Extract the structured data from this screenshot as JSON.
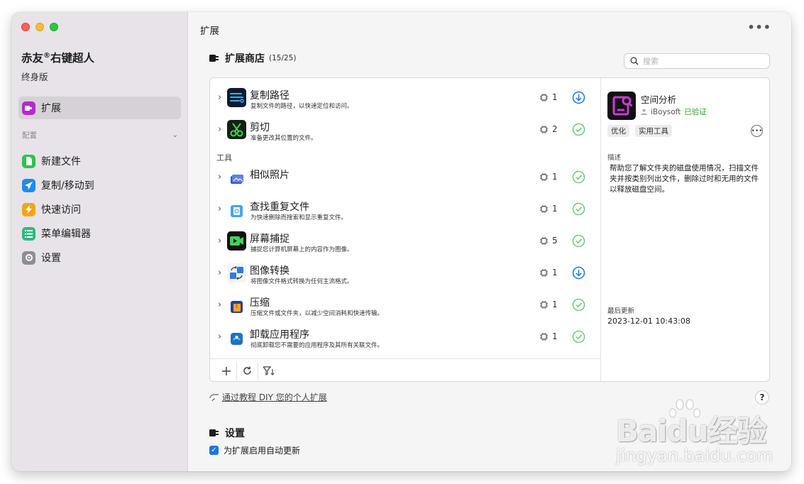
{
  "sidebar": {
    "app_name": "赤友",
    "app_mark": "®",
    "app_name_suffix": "右键超人",
    "edition": "终身版",
    "active_item": {
      "label": "扩展",
      "icon": "extension-icon",
      "color": "#b12cc9"
    },
    "section_label": "配置",
    "items": [
      {
        "label": "新建文件",
        "icon": "new-file-icon",
        "color": "#2ec24b"
      },
      {
        "label": "复制/移动到",
        "icon": "send-icon",
        "color": "#1b8cf0"
      },
      {
        "label": "快速访问",
        "icon": "bolt-icon",
        "color": "#f7a21b"
      },
      {
        "label": "菜单编辑器",
        "icon": "list-icon",
        "color": "#2fba7e"
      },
      {
        "label": "设置",
        "icon": "gear-icon",
        "color": "#8e8e93"
      }
    ]
  },
  "topbar": {
    "title": "扩展",
    "more": "•••"
  },
  "store": {
    "title": "扩展商店",
    "count": "(15/25)",
    "search_placeholder": "搜索",
    "group_label": "工具",
    "rows": [
      {
        "name": "复制路径",
        "desc": "复制文件的路径，以快速定位和访问。",
        "count": "1",
        "status": "download"
      },
      {
        "name": "剪切",
        "desc": "准备更改其位置的文件。",
        "count": "2",
        "status": "installed"
      },
      {
        "name": "相似照片",
        "desc": "",
        "count": "1",
        "status": "installed"
      },
      {
        "name": "查找重复文件",
        "desc": "为快速删除而搜索和显示重复文件。",
        "count": "1",
        "status": "installed"
      },
      {
        "name": "屏幕捕捉",
        "desc": "捕捉您计算机屏幕上的内容作为图像。",
        "count": "5",
        "status": "installed"
      },
      {
        "name": "图像转换",
        "desc": "将图像文件格式转换为任何主流格式。",
        "count": "1",
        "status": "download"
      },
      {
        "name": "压缩",
        "desc": "压缩文件或文件夹，以减少空间消耗和快速传输。",
        "count": "1",
        "status": "installed"
      },
      {
        "name": "卸载应用程序",
        "desc": "彻底卸载您不需要的应用程序及其所有关联文件。",
        "count": "1",
        "status": "installed"
      }
    ]
  },
  "detail": {
    "name": "空间分析",
    "author": "iBoysoft",
    "verified": "已验证",
    "tags": [
      "优化",
      "实用工具"
    ],
    "desc_label": "描述",
    "desc": "帮助您了解文件夹的磁盘使用情况，扫描文件夹并按类别列出文件，删除过时和无用的文件以释放磁盘空间。",
    "updated_label": "最后更新",
    "updated": "2023-12-01 10:43:08"
  },
  "footer": {
    "tutorial_link": "通过教程 DIY 您的个人扩展",
    "help": "?"
  },
  "settings": {
    "title": "设置",
    "auto_update_label": "为扩展启用自动更新"
  },
  "watermark": {
    "brand": "Baidu经验",
    "sub": "jingyan.baidu.com"
  },
  "colors": {
    "accent_blue": "#1c75e6",
    "installed_green": "#5cc36b",
    "verified_green": "#2aa72a"
  }
}
